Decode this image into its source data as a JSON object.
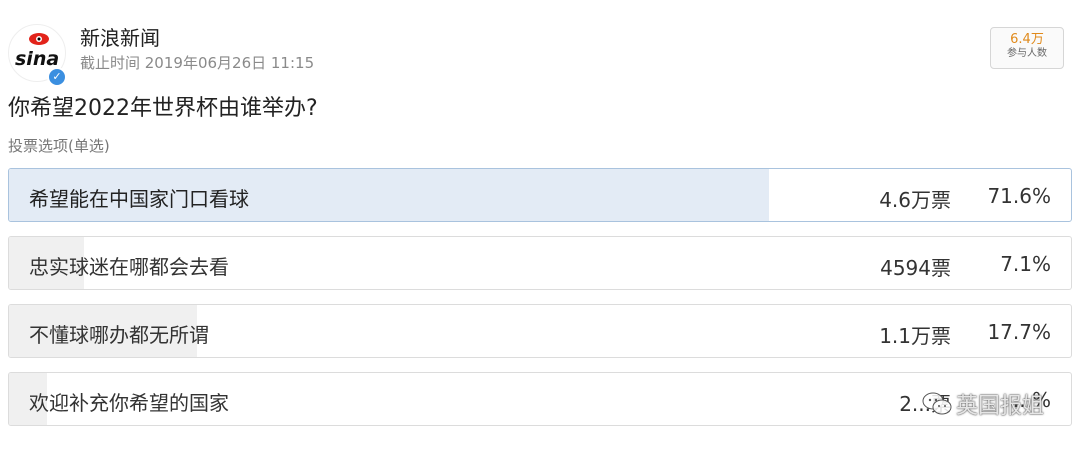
{
  "header": {
    "account_name": "新浪新闻",
    "timestamp": "截止时间 2019年06月26日 11:15",
    "avatar_logo": "sina",
    "verified_icon": "verified-check-icon",
    "participants_count": "6.4万",
    "participants_label": "参与人数"
  },
  "poll": {
    "question": "你希望2022年世界杯由谁举办?",
    "vote_type": "投票选项(单选)",
    "options": [
      {
        "label": "希望能在中国家门口看球",
        "votes": "4.6万票",
        "percent": "71.6%",
        "fraction": 0.716,
        "selected": true
      },
      {
        "label": "忠实球迷在哪都会去看",
        "votes": "4594票",
        "percent": "7.1%",
        "fraction": 0.071,
        "selected": false
      },
      {
        "label": "不懂球哪办都无所谓",
        "votes": "1.1万票",
        "percent": "17.7%",
        "fraction": 0.177,
        "selected": false
      },
      {
        "label": "欢迎补充你希望的国家",
        "votes": "2...票",
        "percent": "...%",
        "fraction": 0.036,
        "selected": false
      }
    ]
  },
  "watermark": {
    "text": "英国报姐",
    "icon": "wechat-icon"
  },
  "colors": {
    "selected_fill": "#e3ebf5",
    "unselected_fill": "#f0f0f0",
    "participants_accent": "#e08a1b",
    "verified_blue": "#3b8fe0",
    "sina_red": "#e2231a"
  }
}
